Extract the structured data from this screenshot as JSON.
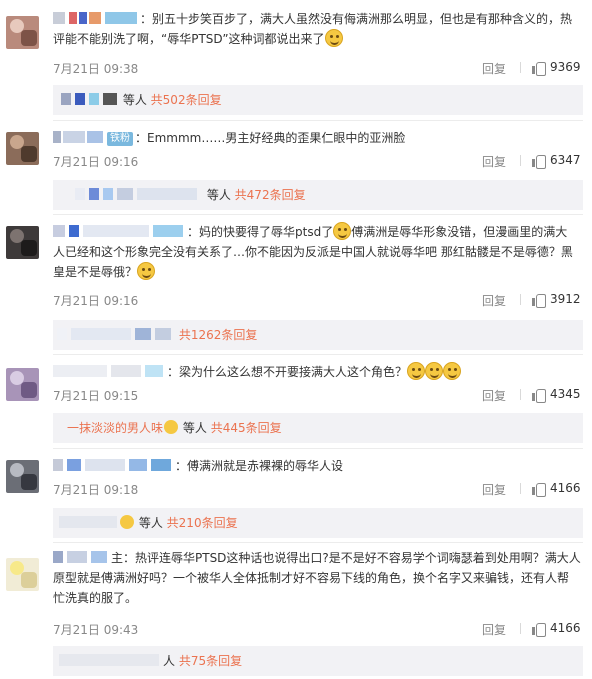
{
  "comments": [
    {
      "pre": "：别五十步笑百步了，满大人虽然没有侮",
      "line2": "满洲那么明显，但也是有那种含义的，热",
      "line3": "评能不能别洗了啊，“辱华PTSD”这种词都说出来了",
      "date": "7月21日 09:38",
      "reply": "回复",
      "likes": "9369",
      "sub_deng": "等人",
      "sub_link": "共502条回复"
    },
    {
      "badge": "铁粉",
      "body": "：Emmmm……男主好经典的歪果仁眼中的亚洲脸",
      "date": "7月21日 09:16",
      "reply": "回复",
      "likes": "6347",
      "sub_deng": "等人",
      "sub_link": "共472条回复"
    },
    {
      "pre": "：妈的快要得了辱华ptsd了",
      "line1b": "傅满洲是辱华形象没错，但漫画里的满大",
      "line2": "人已经和这个形象完全没有关系了…你不能因为反派是中国人就说辱华吧 那红骷髅是不是辱德？黑",
      "line3": "皇是不是辱俄？",
      "date": "7月21日 09:16",
      "reply": "回复",
      "likes": "3912",
      "sub_link": "共1262条回复"
    },
    {
      "body": "：梁为什么这么想不开要接满大人这个角色？",
      "date": "7月21日 09:15",
      "reply": "回复",
      "likes": "4345",
      "sub_name": "一抹淡淡的男人味",
      "sub_deng": "等人",
      "sub_link": "共445条回复"
    },
    {
      "body": "：傅满洲就是赤裸裸的辱华人设",
      "date": "7月21日 09:18",
      "reply": "回复",
      "likes": "4166",
      "sub_deng": "等人",
      "sub_link": "共210条回复"
    },
    {
      "pre": "主：热评连辱华PTSD这种话也说得出口?是不是好不容易学个词嗨瑟着到处用啊？满大人",
      "line2": "原型就是傅满洲好吗？一个被华人全体抵制才好不容易下线的角色，换个名字又来骗钱，还有人帮",
      "line3": "忙洗真的服了。",
      "date": "7月21日 09:43",
      "reply": "回复",
      "likes": "4166",
      "sub_link": "共75条回复",
      "sub_deng": "人"
    }
  ],
  "colors": {
    "link": "#eb7350",
    "meta": "#888888",
    "sub_bg": "#f2f2f5"
  }
}
